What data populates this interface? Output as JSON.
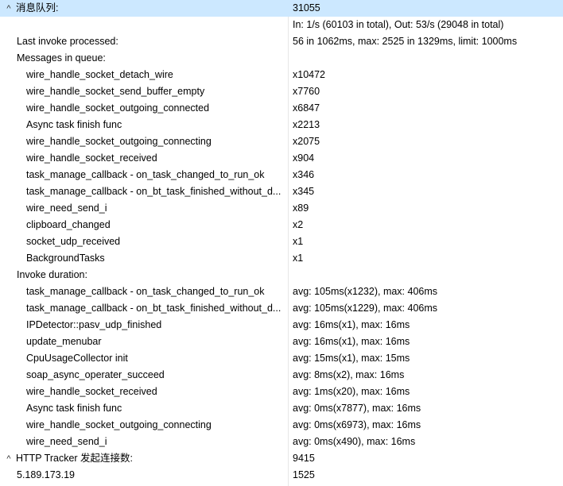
{
  "sections": {
    "queue": {
      "label": "消息队列:",
      "value": "31055",
      "rate_value": "In: 1/s (60103 in total), Out: 53/s (29048 in total)",
      "last_invoke_label": "Last invoke processed:",
      "last_invoke_value": "56 in 1062ms, max: 2525 in 1329ms, limit: 1000ms",
      "messages_label": "Messages in queue:",
      "messages": [
        {
          "name": "wire_handle_socket_detach_wire",
          "value": "x10472"
        },
        {
          "name": "wire_handle_socket_send_buffer_empty",
          "value": "x7760"
        },
        {
          "name": "wire_handle_socket_outgoing_connected",
          "value": "x6847"
        },
        {
          "name": "Async task finish func",
          "value": "x2213"
        },
        {
          "name": "wire_handle_socket_outgoing_connecting",
          "value": "x2075"
        },
        {
          "name": "wire_handle_socket_received",
          "value": "x904"
        },
        {
          "name": "task_manage_callback - on_task_changed_to_run_ok",
          "value": "x346"
        },
        {
          "name": "task_manage_callback - on_bt_task_finished_without_d...",
          "value": "x345"
        },
        {
          "name": "wire_need_send_i",
          "value": "x89"
        },
        {
          "name": "clipboard_changed",
          "value": "x2"
        },
        {
          "name": "socket_udp_received",
          "value": "x1"
        },
        {
          "name": "BackgroundTasks",
          "value": "x1"
        }
      ],
      "invoke_label": "Invoke duration:",
      "invokes": [
        {
          "name": "task_manage_callback - on_task_changed_to_run_ok",
          "value": "avg: 105ms(x1232), max: 406ms"
        },
        {
          "name": "task_manage_callback - on_bt_task_finished_without_d...",
          "value": "avg: 105ms(x1229), max: 406ms"
        },
        {
          "name": "IPDetector::pasv_udp_finished",
          "value": "avg: 16ms(x1), max: 16ms"
        },
        {
          "name": "update_menubar",
          "value": "avg: 16ms(x1), max: 16ms"
        },
        {
          "name": "CpuUsageCollector init",
          "value": "avg: 15ms(x1), max: 15ms"
        },
        {
          "name": "soap_async_operater_succeed",
          "value": "avg: 8ms(x2), max: 16ms"
        },
        {
          "name": "wire_handle_socket_received",
          "value": "avg: 1ms(x20), max: 16ms"
        },
        {
          "name": "Async task finish func",
          "value": "avg: 0ms(x7877), max: 16ms"
        },
        {
          "name": "wire_handle_socket_outgoing_connecting",
          "value": "avg: 0ms(x6973), max: 16ms"
        },
        {
          "name": "wire_need_send_i",
          "value": "avg: 0ms(x490), max: 16ms"
        }
      ]
    },
    "http": {
      "label": "HTTP Tracker 发起连接数:",
      "value": "9415",
      "items": [
        {
          "name": "5.189.173.19",
          "value": "1525"
        }
      ]
    }
  },
  "icons": {
    "expanded": "chevron-up-icon",
    "expanded_glyph": "^"
  },
  "colors": {
    "selected_background": "#cce8ff",
    "divider": "#e6e6e6"
  }
}
